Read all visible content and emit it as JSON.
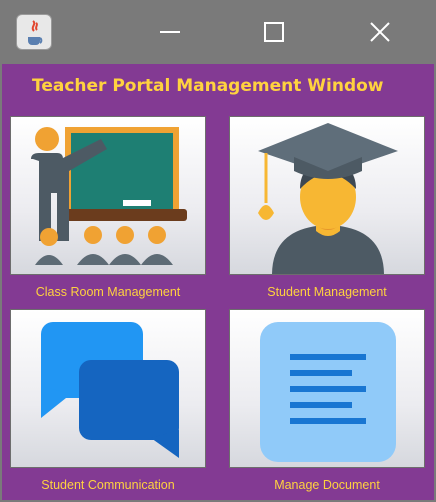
{
  "window": {
    "title": "Teacher Portal Management Window",
    "controls": {
      "minimize": "minimize",
      "maximize": "maximize",
      "close": "close"
    }
  },
  "tiles": [
    {
      "label": "Class Room Management",
      "icon": "classroom-teacher-icon"
    },
    {
      "label": "Student Management",
      "icon": "graduate-student-icon"
    },
    {
      "label": "Student Communication",
      "icon": "chat-bubbles-icon"
    },
    {
      "label": "Manage Document",
      "icon": "document-icon"
    }
  ],
  "colors": {
    "background": "#833a93",
    "label_text": "#ffd23f",
    "titlebar": "#7a7a7a"
  }
}
